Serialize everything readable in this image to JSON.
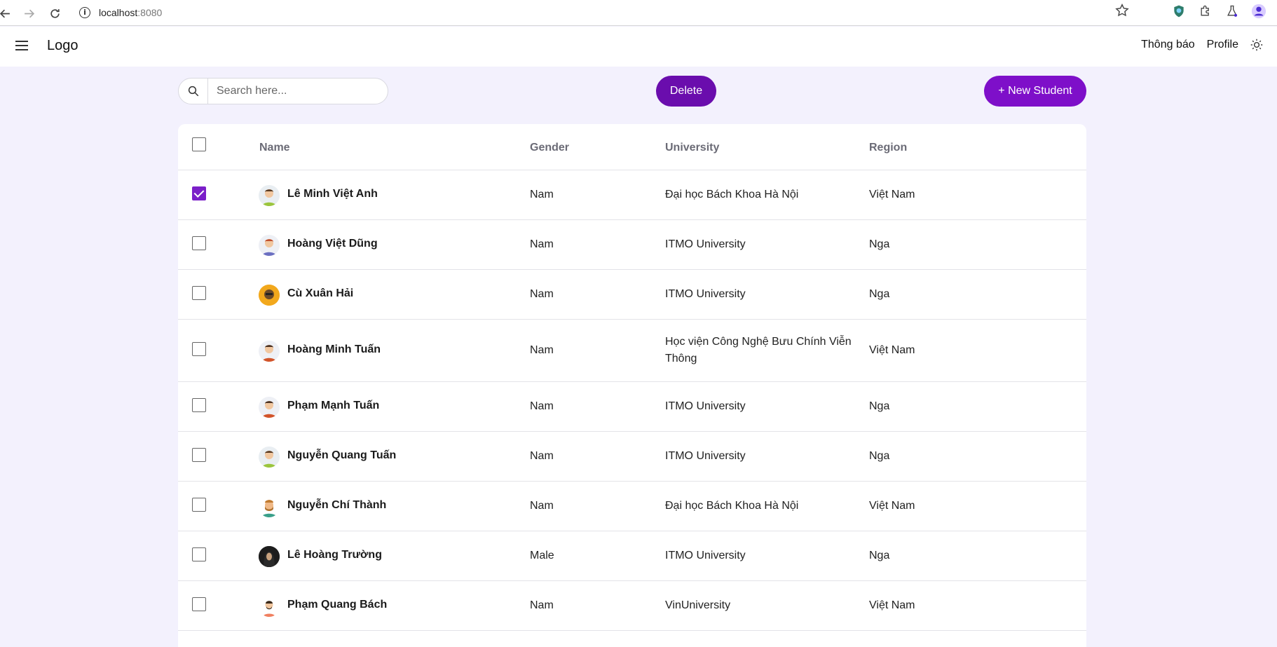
{
  "browser": {
    "url_host": "localhost",
    "url_port": ":8080"
  },
  "header": {
    "logo": "Logo",
    "nav": [
      "Thông báo",
      "Profile"
    ]
  },
  "toolbar": {
    "search_placeholder": "Search here...",
    "delete_label": "Delete",
    "new_label": "+ New Student"
  },
  "table": {
    "columns": [
      "Name",
      "Gender",
      "University",
      "Region"
    ],
    "rows": [
      {
        "name": "Lê Minh Việt Anh",
        "gender": "Nam",
        "university": "Đại học Bách Khoa Hà Nội",
        "region": "Việt Nam",
        "checked": true
      },
      {
        "name": "Hoàng Việt Dũng",
        "gender": "Nam",
        "university": "ITMO University",
        "region": "Nga",
        "checked": false
      },
      {
        "name": "Cù Xuân Hải",
        "gender": "Nam",
        "university": "ITMO University",
        "region": "Nga",
        "checked": false
      },
      {
        "name": "Hoàng Minh Tuấn",
        "gender": "Nam",
        "university": "Học viện Công Nghệ Bưu Chính Viễn Thông",
        "region": "Việt Nam",
        "checked": false
      },
      {
        "name": "Phạm Mạnh Tuấn",
        "gender": "Nam",
        "university": "ITMO University",
        "region": "Nga",
        "checked": false
      },
      {
        "name": "Nguyễn Quang Tuấn",
        "gender": "Nam",
        "university": "ITMO University",
        "region": "Nga",
        "checked": false
      },
      {
        "name": "Nguyễn Chí Thành",
        "gender": "Nam",
        "university": "Đại học Bách Khoa Hà Nội",
        "region": "Việt Nam",
        "checked": false
      },
      {
        "name": "Lê Hoàng Trường",
        "gender": "Male",
        "university": "ITMO University",
        "region": "Nga",
        "checked": false
      },
      {
        "name": "Phạm Quang Bách",
        "gender": "Nam",
        "university": "VinUniversity",
        "region": "Việt Nam",
        "checked": false
      }
    ]
  },
  "colors": {
    "accent": "#6a0dad",
    "background": "#f3f1fd"
  }
}
